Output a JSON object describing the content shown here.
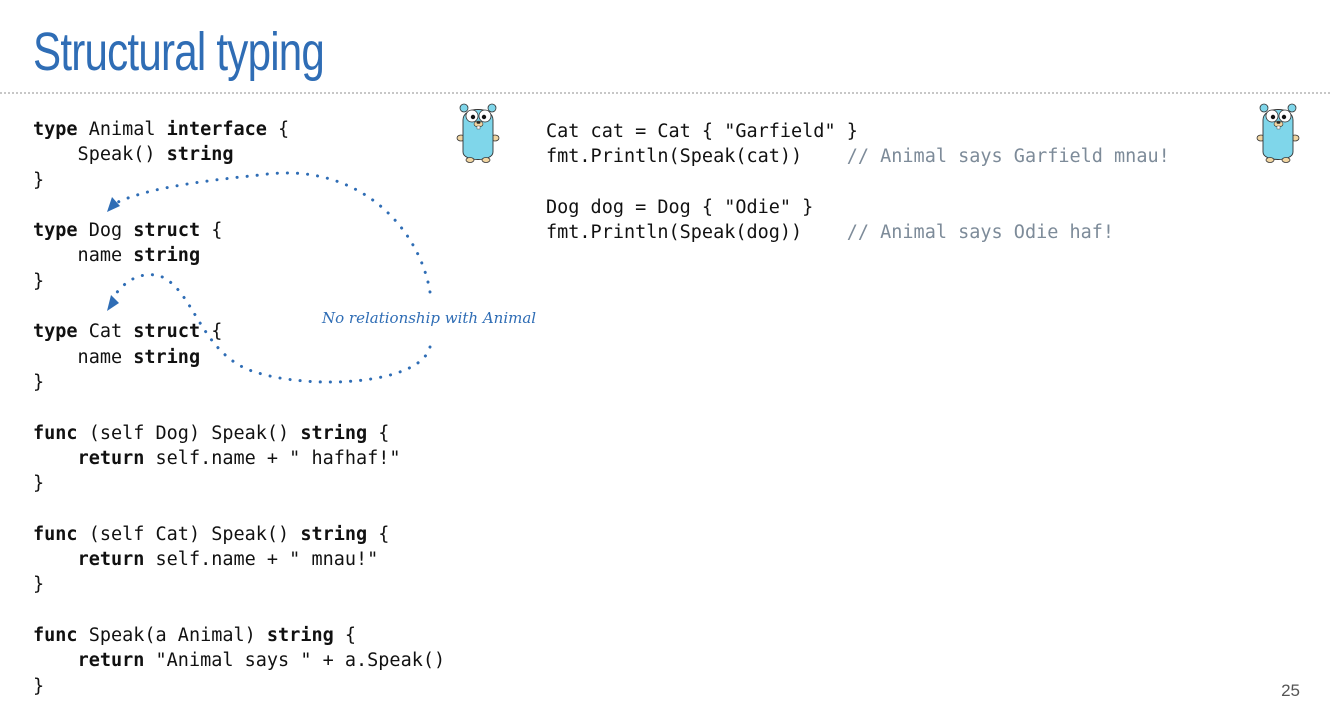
{
  "slide": {
    "title": "Structural typing",
    "page_number": "25"
  },
  "left_code": {
    "l1": {
      "kw1": "type",
      "t1": " Animal ",
      "kw2": "interface",
      "t2": " {"
    },
    "l2": {
      "t1": "    Speak() ",
      "kw1": "string"
    },
    "l3": {
      "t1": "}"
    },
    "l5": {
      "kw1": "type",
      "t1": " Dog ",
      "kw2": "struct",
      "t2": " {"
    },
    "l6": {
      "t1": "    name ",
      "kw1": "string"
    },
    "l7": {
      "t1": "}"
    },
    "l9": {
      "kw1": "type",
      "t1": " Cat ",
      "kw2": "struct",
      "t2": " {"
    },
    "l10": {
      "t1": "    name ",
      "kw1": "string"
    },
    "l11": {
      "t1": "}"
    },
    "l13": {
      "kw1": "func",
      "t1": " (self Dog) Speak() ",
      "kw2": "string",
      "t2": " {"
    },
    "l14": {
      "t0": "    ",
      "kw1": "return",
      "t1": " self.name + \" hafhaf!\""
    },
    "l15": {
      "t1": "}"
    },
    "l17": {
      "kw1": "func",
      "t1": " (self Cat) Speak() ",
      "kw2": "string",
      "t2": " {"
    },
    "l18": {
      "t0": "    ",
      "kw1": "return",
      "t1": " self.name + \" mnau!\""
    },
    "l19": {
      "t1": "}"
    },
    "l21": {
      "kw1": "func",
      "t1": " Speak(a Animal) ",
      "kw2": "string",
      "t2": " {"
    },
    "l22": {
      "t0": "    ",
      "kw1": "return",
      "t1": " \"Animal says \" + a.Speak()"
    },
    "l23": {
      "t1": "}"
    }
  },
  "right_code": {
    "r1": {
      "code": "Cat cat = Cat { \"Garfield\" }"
    },
    "r2": {
      "code": "fmt.Println(Speak(cat))    ",
      "comment": "// Animal says Garfield mnau!"
    },
    "r4": {
      "code": "Dog dog = Dog { \"Odie\" }"
    },
    "r5": {
      "code": "fmt.Println(Speak(dog))    ",
      "comment": "// Animal says Odie haf!"
    }
  },
  "annotation": {
    "text": "No relationship with Animal"
  },
  "icons": {
    "left_gopher": "gopher-mascot-icon",
    "right_gopher": "gopher-mascot-icon"
  },
  "colors": {
    "title": "#2f6db5",
    "annotation": "#2f6db5",
    "comment": "#7d8b99",
    "gopher_body": "#7fd6ea"
  }
}
